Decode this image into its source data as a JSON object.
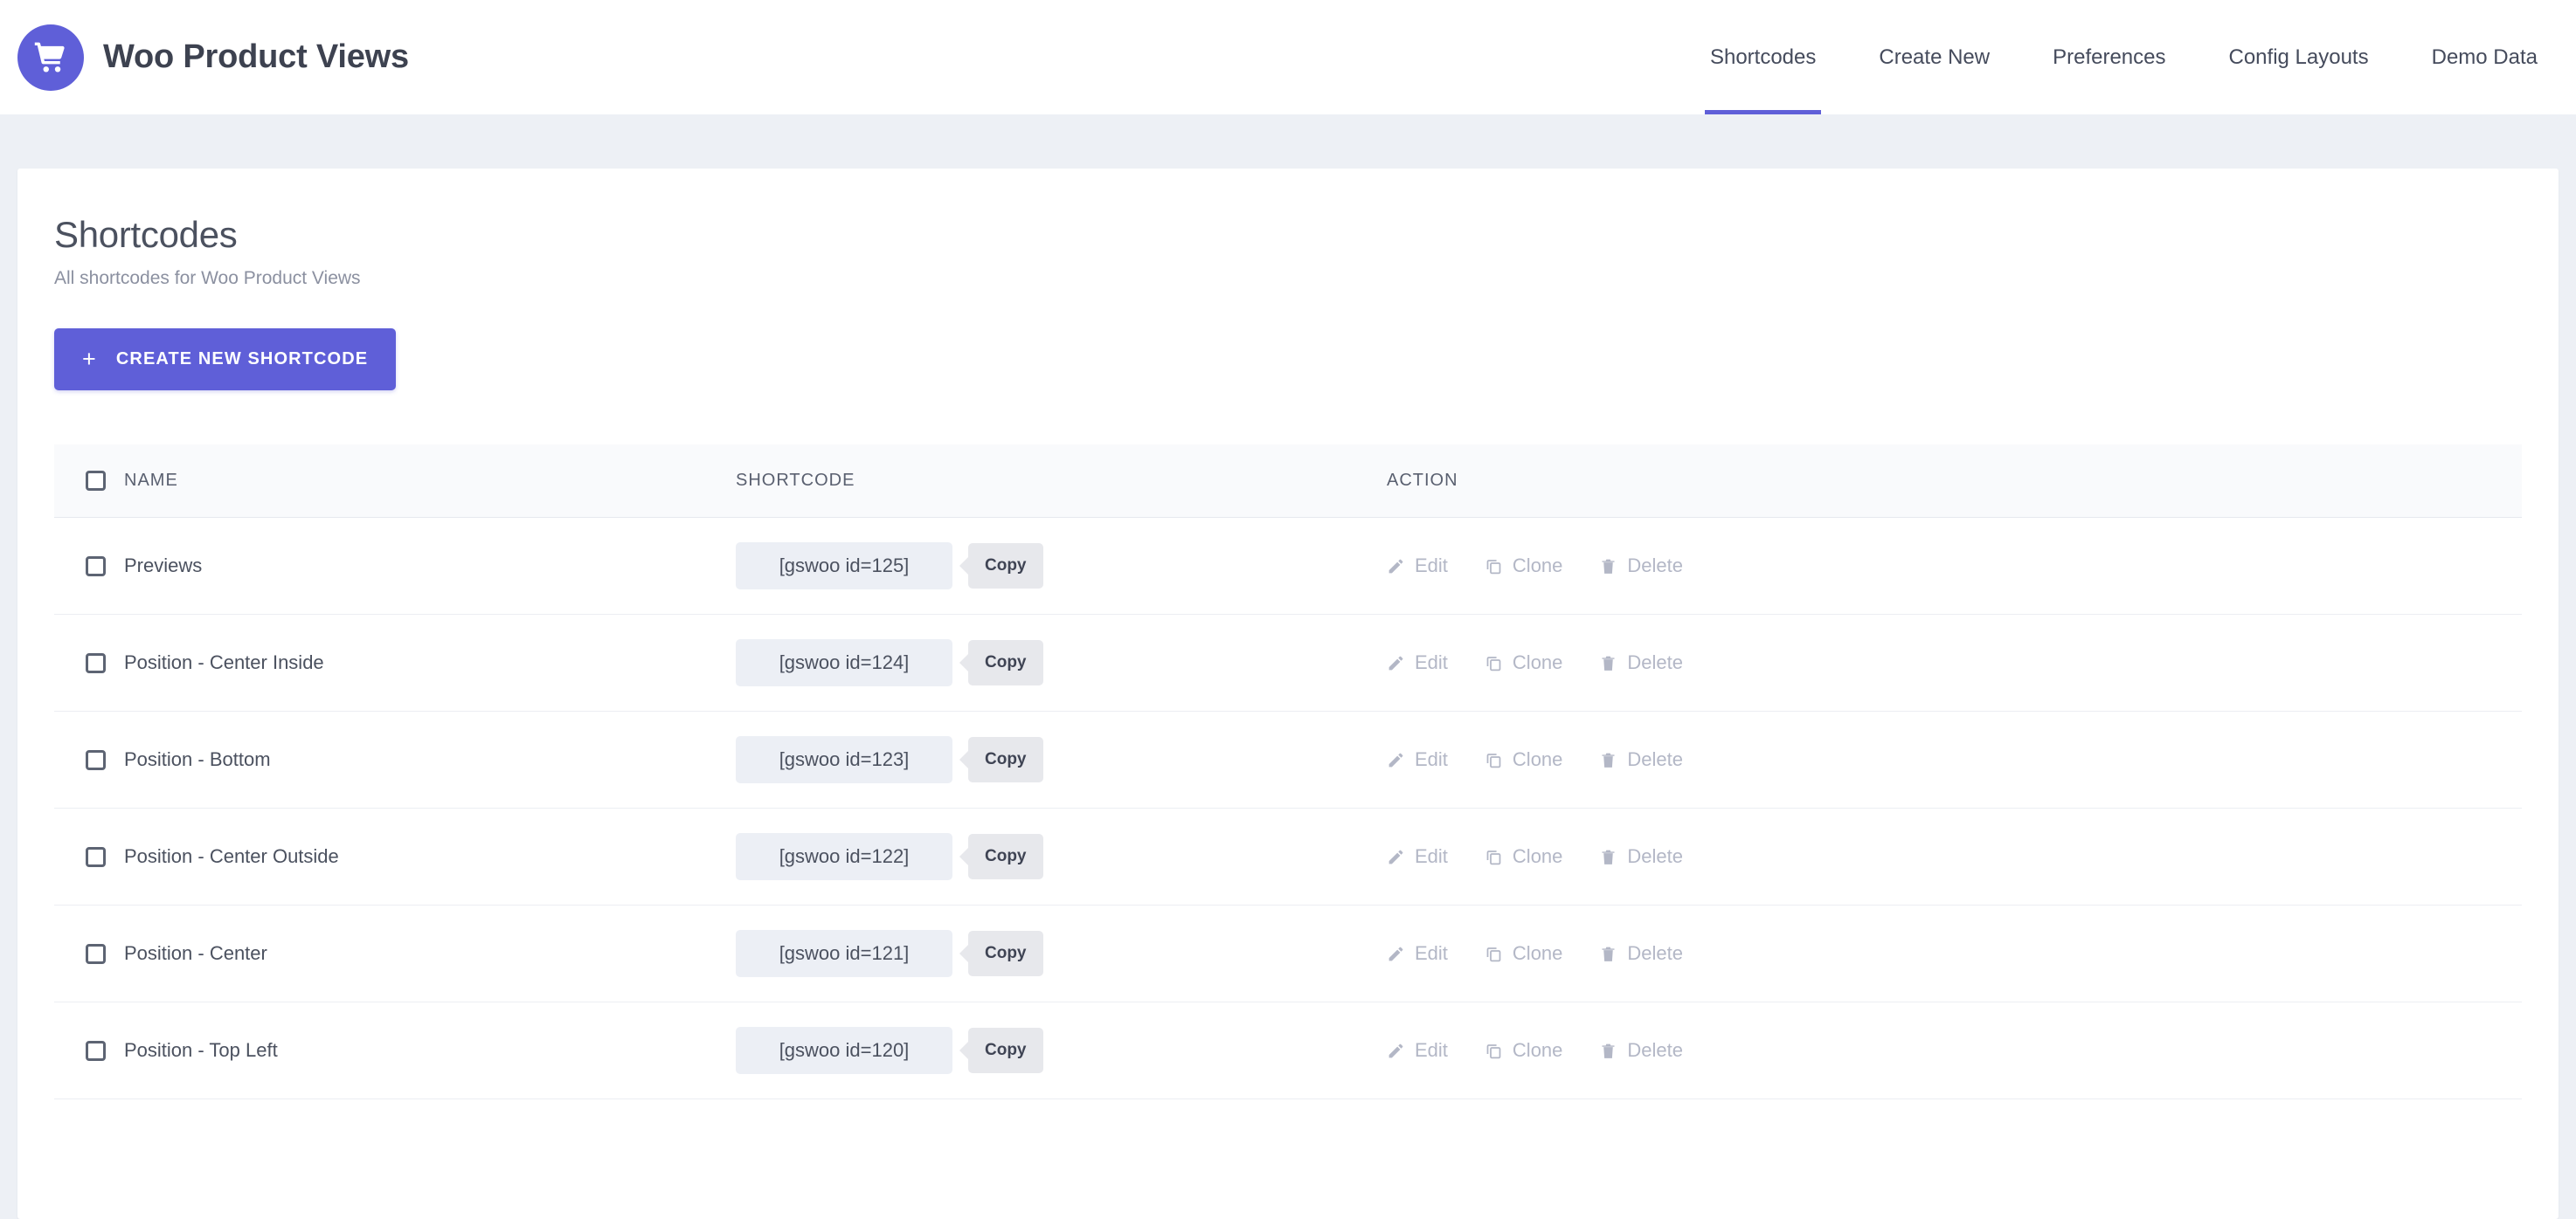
{
  "header": {
    "brand_title": "Woo Product Views",
    "logo_icon": "shopping-cart-icon",
    "brand_color": "#5f5fd8",
    "nav": [
      {
        "label": "Shortcodes",
        "active": true
      },
      {
        "label": "Create New",
        "active": false
      },
      {
        "label": "Preferences",
        "active": false
      },
      {
        "label": "Config Layouts",
        "active": false
      },
      {
        "label": "Demo Data",
        "active": false
      }
    ]
  },
  "main": {
    "title": "Shortcodes",
    "subtitle": "All shortcodes for Woo Product Views",
    "create_button": {
      "label": "CREATE NEW SHORTCODE",
      "icon": "plus-icon",
      "color": "#5f5fd8"
    },
    "table": {
      "columns": {
        "select": "",
        "name": "NAME",
        "shortcode": "SHORTCODE",
        "action": "ACTION"
      },
      "row_actions": {
        "edit": "Edit",
        "clone": "Clone",
        "delete": "Delete"
      },
      "copy_label": "Copy",
      "rows": [
        {
          "name": "Previews",
          "shortcode": "[gswoo id=125]",
          "checked": false
        },
        {
          "name": "Position - Center Inside",
          "shortcode": "[gswoo id=124]",
          "checked": false
        },
        {
          "name": "Position - Bottom",
          "shortcode": "[gswoo id=123]",
          "checked": false
        },
        {
          "name": "Position - Center Outside",
          "shortcode": "[gswoo id=122]",
          "checked": false
        },
        {
          "name": "Position - Center",
          "shortcode": "[gswoo id=121]",
          "checked": false
        },
        {
          "name": "Position - Top Left",
          "shortcode": "[gswoo id=120]",
          "checked": false
        }
      ]
    }
  }
}
